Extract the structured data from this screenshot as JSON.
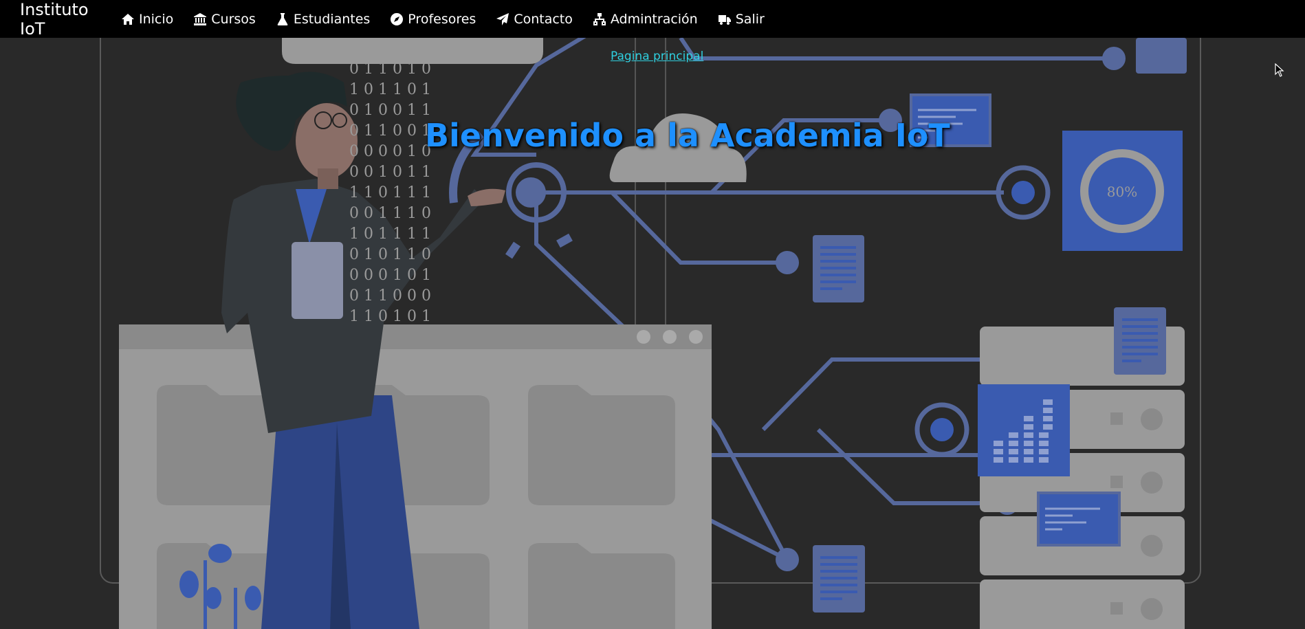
{
  "navbar": {
    "brand_line1": "Instituto",
    "brand_line2": "IoT",
    "items": [
      {
        "label": "Inicio",
        "icon": "home-icon"
      },
      {
        "label": "Cursos",
        "icon": "bank-icon"
      },
      {
        "label": "Estudiantes",
        "icon": "flask-icon"
      },
      {
        "label": "Profesores",
        "icon": "compass-icon"
      },
      {
        "label": "Contacto",
        "icon": "paper-plane-icon"
      },
      {
        "label": "Admintración",
        "icon": "sitemap-icon"
      },
      {
        "label": "Salir",
        "icon": "truck-icon"
      }
    ]
  },
  "hero": {
    "link": "Pagina principal",
    "title": "Bienvenido a la Academia IoT",
    "gauge_label": "80%",
    "binary_rows": [
      "0 1 1 0 1 0",
      "1 0 1 1 0 1",
      "0 1 0 0 1 1",
      "0 1 1 0 0 1",
      "0 0 0 0 1 0",
      "0 0 1 0 1 1",
      "1 1 0 1 1 1",
      "0 0 1 1 1 0",
      "1 0 1 1 1 1",
      "0 1 0 1 1 0",
      "0 0 0 1 0 1",
      "0 1 1 0 0 0",
      "1 1 0 1 0 1"
    ]
  },
  "colors": {
    "background": "#292929",
    "navbar": "#000000",
    "title": "#1e90ff",
    "link": "#2fd0e0",
    "accent": "#3a5bb0"
  }
}
